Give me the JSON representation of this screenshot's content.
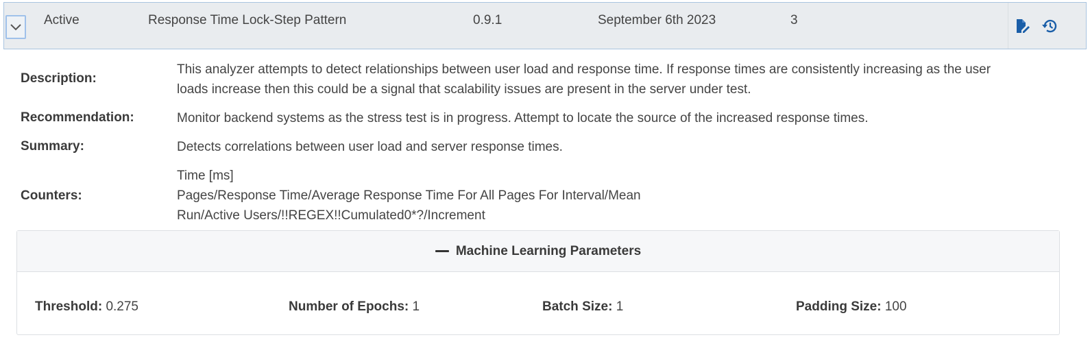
{
  "row": {
    "status": "Active",
    "name": "Response Time Lock-Step Pattern",
    "version": "0.9.1",
    "date": "September 6th 2023",
    "count": "3",
    "icons": {
      "expand": "chevron-down-icon",
      "edit": "edit-document-icon",
      "history": "history-icon"
    },
    "accent_color": "#1a5ea8"
  },
  "details": {
    "description_label": "Description:",
    "description_line1": "This analyzer attempts to detect relationships between user load and response time. If response times are consistently increasing as the user",
    "description_line2": "loads increase then this could be a signal that scalability issues are present in the server under test.",
    "recommendation_label": "Recommendation:",
    "recommendation_text": "Monitor backend systems as the stress test is in progress. Attempt to locate the source of the increased response times.",
    "summary_label": "Summary:",
    "summary_text": "Detects correlations between user load and server response times.",
    "counters_label": "Counters:",
    "counters": [
      "Time [ms]",
      "Pages/Response Time/Average Response Time For All Pages For Interval/Mean",
      "Run/Active Users/!!REGEX!!Cumulated0*?/Increment"
    ]
  },
  "ml_parameters": {
    "title": "Machine Learning Parameters",
    "threshold_label": "Threshold:",
    "threshold_value": "0.275",
    "epochs_label": "Number of Epochs:",
    "epochs_value": "1",
    "batch_label": "Batch Size:",
    "batch_value": "1",
    "padding_label": "Padding Size:",
    "padding_value": "100"
  }
}
